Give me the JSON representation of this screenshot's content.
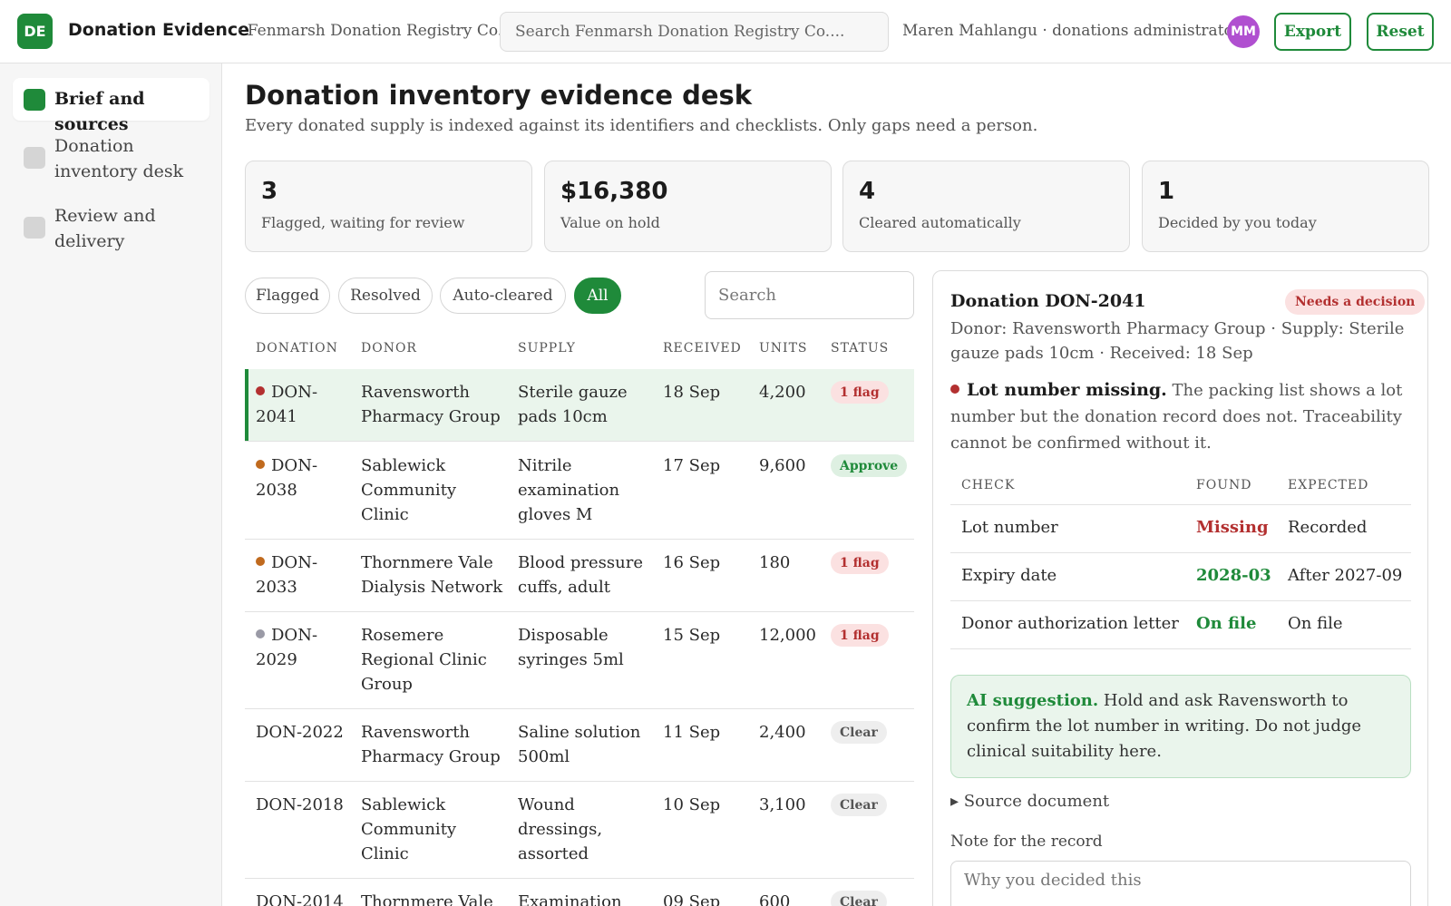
{
  "topbar": {
    "logo_initials": "DE",
    "app_title": "Donation Evidence",
    "org_name": "· Fenmarsh Donation Registry Co.",
    "search_placeholder": "Search Fenmarsh Donation Registry Co....",
    "user_text": "Maren Mahlangu · donations administrator",
    "avatar_initials": "MM",
    "export_label": "Export",
    "reset_label": "Reset"
  },
  "sidebar": {
    "items": [
      {
        "label": "Brief and sources",
        "active": true
      },
      {
        "label": "Donation inventory desk",
        "active": false
      },
      {
        "label": "Review and delivery",
        "active": false
      }
    ]
  },
  "main": {
    "title": "Donation inventory evidence desk",
    "subtitle": "Every donated supply is indexed against its identifiers and checklists. Only gaps need a person."
  },
  "stats": [
    {
      "value": "3",
      "label": "Flagged, waiting for review"
    },
    {
      "value": "$16,380",
      "label": "Value on hold"
    },
    {
      "value": "4",
      "label": "Cleared automatically"
    },
    {
      "value": "1",
      "label": "Decided by you today"
    }
  ],
  "filters": {
    "items": [
      "Flagged",
      "Resolved",
      "Auto-cleared",
      "All"
    ],
    "active": "All",
    "search_placeholder": "Search"
  },
  "table": {
    "headers": [
      "DONATION",
      "DONOR",
      "SUPPLY",
      "RECEIVED",
      "UNITS",
      "STATUS"
    ],
    "rows": [
      {
        "id_a": "DON-",
        "id_b": "2041",
        "donor": "Ravensworth Pharmacy Group",
        "supply": "Sterile gauze pads 10cm",
        "received": "18 Sep",
        "units": "4,200",
        "status": "1 flag",
        "status_kind": "flag",
        "dot_color": "#b33030"
      },
      {
        "id_a": "DON-",
        "id_b": "2038",
        "donor": "Sablewick Community Clinic",
        "supply": "Nitrile examination gloves M",
        "received": "17 Sep",
        "units": "9,600",
        "status": "Approve",
        "status_kind": "approve",
        "dot_color": "#c06a1e"
      },
      {
        "id_a": "DON-",
        "id_b": "2033",
        "donor": "Thornmere Vale Dialysis Network",
        "supply": "Blood pressure cuffs, adult",
        "received": "16 Sep",
        "units": "180",
        "status": "1 flag",
        "status_kind": "flag",
        "dot_color": "#c06a1e"
      },
      {
        "id_a": "DON-",
        "id_b": "2029",
        "donor": "Rosemere Regional Clinic Group",
        "supply": "Disposable syringes 5ml",
        "received": "15 Sep",
        "units": "12,000",
        "status": "1 flag",
        "status_kind": "flag",
        "dot_color": "#9a9aa6"
      },
      {
        "id_a": "DON-2022",
        "id_b": "",
        "donor": "Ravensworth Pharmacy Group",
        "supply": "Saline solution 500ml",
        "received": "11 Sep",
        "units": "2,400",
        "status": "Clear",
        "status_kind": "clear",
        "dot_color": ""
      },
      {
        "id_a": "DON-2018",
        "id_b": "",
        "donor": "Sablewick Community Clinic",
        "supply": "Wound dressings, assorted",
        "received": "10 Sep",
        "units": "3,100",
        "status": "Clear",
        "status_kind": "clear",
        "dot_color": ""
      },
      {
        "id_a": "DON-2014",
        "id_b": "",
        "donor": "Thornmere Vale",
        "supply": "Examination",
        "received": "09 Sep",
        "units": "600",
        "status": "Clear",
        "status_kind": "clear",
        "dot_color": ""
      }
    ]
  },
  "detail": {
    "title": "Donation DON-2041",
    "badge": "Needs a decision",
    "meta": "Donor: Ravensworth Pharmacy Group · Supply: Sterile gauze pads 10cm · Received: 18 Sep",
    "issue_title": "Lot number missing.",
    "issue_text": "The packing list shows a lot number but the donation record does not. Traceability cannot be confirmed without it.",
    "checks_headers": [
      "CHECK",
      "FOUND",
      "EXPECTED"
    ],
    "checks": [
      {
        "check": "Lot number",
        "found": "Missing",
        "expected": "Recorded",
        "found_color": "#b33030"
      },
      {
        "check": "Expiry date",
        "found": "2028-03",
        "expected": "After 2027-09",
        "found_color": "#1f8a3a"
      },
      {
        "check": "Donor authorization letter",
        "found": "On file",
        "expected": "On file",
        "found_color": "#1f8a3a"
      }
    ],
    "ai_label": "AI suggestion.",
    "ai_text": "Hold and ask Ravensworth to confirm the lot number in writing. Do not judge clinical suitability here.",
    "source_toggle": "▸ Source document",
    "note_label": "Note for the record",
    "note_placeholder": "Why you decided this"
  },
  "colors": {
    "accent": "#1f8a3a",
    "danger": "#b33030",
    "selected_row": "#eaf5ec"
  }
}
